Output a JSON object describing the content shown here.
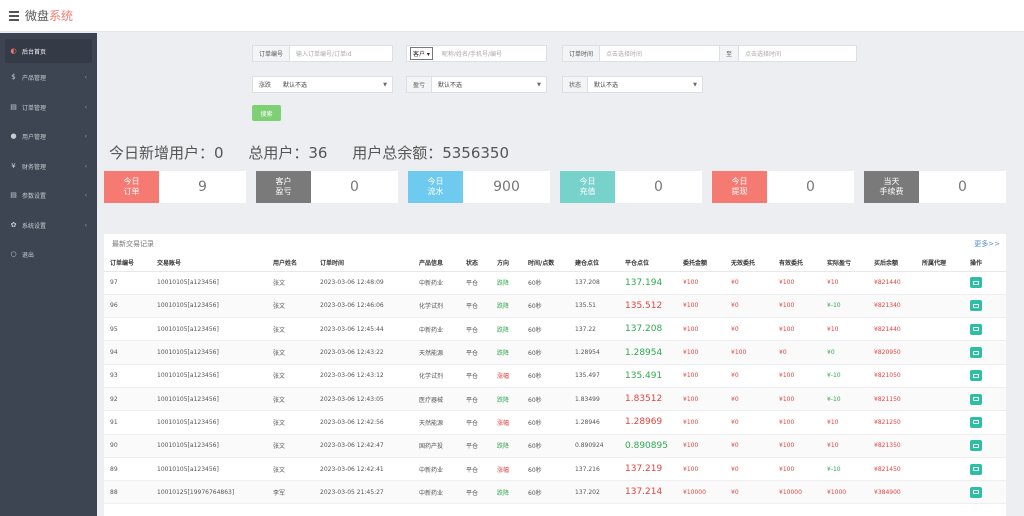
{
  "app": {
    "title_part1": "微盘",
    "title_part2": "系统"
  },
  "sidebar": {
    "items": [
      {
        "label": "后台首页",
        "icon": "◐",
        "active": true,
        "arrow": ""
      },
      {
        "label": "产品管理",
        "icon": "$",
        "arrow": "‹"
      },
      {
        "label": "订单管理",
        "icon": "▤",
        "arrow": "‹"
      },
      {
        "label": "用户管理",
        "icon": "●",
        "arrow": "‹"
      },
      {
        "label": "财务管理",
        "icon": "¥",
        "arrow": "‹"
      },
      {
        "label": "参数设置",
        "icon": "▤",
        "arrow": "‹"
      },
      {
        "label": "系统设置",
        "icon": "✿",
        "arrow": "‹"
      },
      {
        "label": "退出",
        "icon": "○",
        "arrow": ""
      }
    ]
  },
  "filters": {
    "order_no": {
      "label": "订单编号",
      "placeholder": "输入订单编号/订单id"
    },
    "customer": {
      "select": "客户 ▾",
      "placeholder": "昵称/姓名/手机号/编号"
    },
    "order_time": {
      "label": "订单时间",
      "placeholder": "点击选择时间",
      "to": "至",
      "placeholder2": "点击选择时间"
    },
    "direction": {
      "label": "涨跌",
      "value": "默认不选"
    },
    "profit": {
      "label": "盈亏",
      "value": "默认不选"
    },
    "status": {
      "label": "状态",
      "value": "默认不选"
    },
    "search_btn": "搜索"
  },
  "summary": {
    "today_new_users": "今日新增用户：0",
    "total_users": "总用户：36",
    "total_balance": "用户总余额：5356350"
  },
  "cards": [
    {
      "tag": "今日\n订单",
      "value": "9",
      "color": "#f57a72"
    },
    {
      "tag": "客户\n盈亏",
      "value": "0",
      "color": "#7a7a7a"
    },
    {
      "tag": "今日\n流水",
      "value": "900",
      "color": "#6ecbef"
    },
    {
      "tag": "今日\n充值",
      "value": "0",
      "color": "#78d2cc"
    },
    {
      "tag": "今日\n提现",
      "value": "0",
      "color": "#f57a72"
    },
    {
      "tag": "当天\n手续费",
      "value": "0",
      "color": "#7a7a7a"
    }
  ],
  "table": {
    "title": "最新交易记录",
    "more": "更多>>",
    "headers": [
      "订单编号",
      "交易账号",
      "用户姓名",
      "订单时间",
      "产品信息",
      "状态",
      "方向",
      "时间/点数",
      "建仓点位",
      "平仓点位",
      "委托金额",
      "无效委托",
      "有效委托",
      "实际盈亏",
      "买后余额",
      "所属代理",
      "操作"
    ],
    "rows": [
      [
        "97",
        "10010105[a123456]",
        "张文",
        "2023-03-06 12:48:09",
        "中新药业",
        "平仓",
        "跌降",
        "60秒",
        "137.208",
        "137.194",
        "¥100",
        "¥0",
        "¥100",
        "¥10",
        "¥821440",
        ""
      ],
      [
        "96",
        "10010105[a123456]",
        "张文",
        "2023-03-06 12:46:06",
        "化学试剂",
        "平仓",
        "跌降",
        "60秒",
        "135.51",
        "135.512",
        "¥100",
        "¥0",
        "¥100",
        "¥-10",
        "¥821340",
        ""
      ],
      [
        "95",
        "10010105[a123456]",
        "张文",
        "2023-03-06 12:45:44",
        "中新药业",
        "平仓",
        "跌降",
        "60秒",
        "137.22",
        "137.208",
        "¥100",
        "¥0",
        "¥100",
        "¥10",
        "¥821440",
        ""
      ],
      [
        "94",
        "10010105[a123456]",
        "张文",
        "2023-03-06 12:43:22",
        "天然能源",
        "平仓",
        "跌降",
        "60秒",
        "1.28954",
        "1.28954",
        "¥100",
        "¥100",
        "¥0",
        "¥0",
        "¥820950",
        ""
      ],
      [
        "93",
        "10010105[a123456]",
        "张文",
        "2023-03-06 12:43:12",
        "化学试剂",
        "平仓",
        "涨幅",
        "60秒",
        "135.497",
        "135.491",
        "¥100",
        "¥0",
        "¥100",
        "¥-10",
        "¥821050",
        ""
      ],
      [
        "92",
        "10010105[a123456]",
        "张文",
        "2023-03-06 12:43:05",
        "医疗器械",
        "平仓",
        "跌降",
        "60秒",
        "1.83499",
        "1.83512",
        "¥100",
        "¥0",
        "¥100",
        "¥-10",
        "¥821150",
        ""
      ],
      [
        "91",
        "10010105[a123456]",
        "张文",
        "2023-03-06 12:42:56",
        "天然能源",
        "平仓",
        "涨幅",
        "60秒",
        "1.28946",
        "1.28969",
        "¥100",
        "¥0",
        "¥100",
        "¥10",
        "¥821250",
        ""
      ],
      [
        "90",
        "10010105[a123456]",
        "张文",
        "2023-03-06 12:42:47",
        "国药产投",
        "平仓",
        "跌降",
        "60秒",
        "0.890924",
        "0.890895",
        "¥100",
        "¥0",
        "¥100",
        "¥10",
        "¥821350",
        ""
      ],
      [
        "89",
        "10010105[a123456]",
        "张文",
        "2023-03-06 12:42:41",
        "中新药业",
        "平仓",
        "涨幅",
        "60秒",
        "137.216",
        "137.219",
        "¥100",
        "¥0",
        "¥100",
        "¥-10",
        "¥821450",
        ""
      ],
      [
        "88",
        "10010125[19976764863]",
        "李军",
        "2023-03-05 21:45:27",
        "中新药业",
        "平仓",
        "跌降",
        "60秒",
        "137.202",
        "137.214",
        "¥10000",
        "¥0",
        "¥10000",
        "¥1000",
        "¥384900",
        ""
      ]
    ],
    "close_colors": [
      "green",
      "red",
      "green",
      "green",
      "green",
      "red",
      "red",
      "green",
      "red",
      "red"
    ],
    "profit_colors": [
      "red",
      "green",
      "red",
      "green",
      "green",
      "green",
      "red",
      "red",
      "green",
      "red"
    ]
  }
}
